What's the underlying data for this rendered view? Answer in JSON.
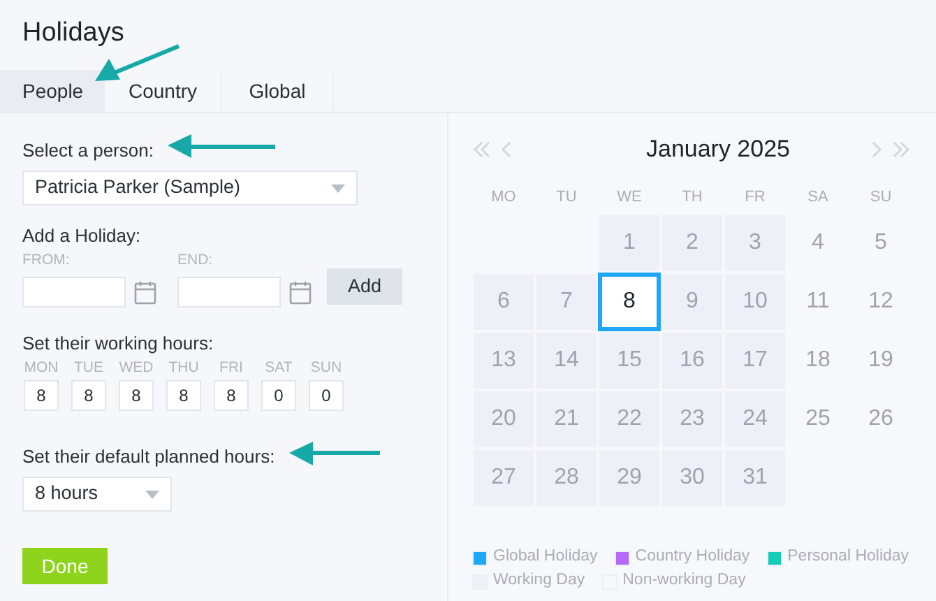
{
  "title": "Holidays",
  "tabs": [
    {
      "label": "People",
      "selected": true
    },
    {
      "label": "Country",
      "selected": false
    },
    {
      "label": "Global",
      "selected": false
    }
  ],
  "person": {
    "label": "Select a person:",
    "value": "Patricia Parker (Sample)"
  },
  "add_holiday": {
    "label": "Add a Holiday:",
    "from_label": "FROM:",
    "end_label": "END:",
    "button": "Add"
  },
  "working_hours": {
    "label": "Set their working hours:",
    "days": [
      {
        "day": "MON",
        "hours": "8"
      },
      {
        "day": "TUE",
        "hours": "8"
      },
      {
        "day": "WED",
        "hours": "8"
      },
      {
        "day": "THU",
        "hours": "8"
      },
      {
        "day": "FRI",
        "hours": "8"
      },
      {
        "day": "SAT",
        "hours": "0"
      },
      {
        "day": "SUN",
        "hours": "0"
      }
    ]
  },
  "planned_hours": {
    "label": "Set their default planned hours:",
    "value": "8 hours"
  },
  "done_button": "Done",
  "calendar": {
    "month": "January 2025",
    "weekdays": [
      "MO",
      "TU",
      "WE",
      "TH",
      "FR",
      "SA",
      "SU"
    ],
    "weeks": [
      [
        {
          "day": "1",
          "kind": "working",
          "selected": false
        },
        {
          "day": "2",
          "kind": "working",
          "selected": false
        },
        {
          "day": "3",
          "kind": "working",
          "selected": false
        },
        {
          "day": "4",
          "kind": "nonworking",
          "selected": false
        },
        {
          "day": "5",
          "kind": "nonworking",
          "selected": false
        }
      ],
      [
        {
          "day": "6",
          "kind": "working",
          "selected": false
        },
        {
          "day": "7",
          "kind": "working",
          "selected": false
        },
        {
          "day": "8",
          "kind": "working",
          "selected": true
        },
        {
          "day": "9",
          "kind": "working",
          "selected": false
        },
        {
          "day": "10",
          "kind": "working",
          "selected": false
        },
        {
          "day": "11",
          "kind": "nonworking",
          "selected": false
        },
        {
          "day": "12",
          "kind": "nonworking",
          "selected": false
        }
      ],
      [
        {
          "day": "13",
          "kind": "working",
          "selected": false
        },
        {
          "day": "14",
          "kind": "working",
          "selected": false
        },
        {
          "day": "15",
          "kind": "working",
          "selected": false
        },
        {
          "day": "16",
          "kind": "working",
          "selected": false
        },
        {
          "day": "17",
          "kind": "working",
          "selected": false
        },
        {
          "day": "18",
          "kind": "nonworking",
          "selected": false
        },
        {
          "day": "19",
          "kind": "nonworking",
          "selected": false
        }
      ],
      [
        {
          "day": "20",
          "kind": "working",
          "selected": false
        },
        {
          "day": "21",
          "kind": "working",
          "selected": false
        },
        {
          "day": "22",
          "kind": "working",
          "selected": false
        },
        {
          "day": "23",
          "kind": "working",
          "selected": false
        },
        {
          "day": "24",
          "kind": "working",
          "selected": false
        },
        {
          "day": "25",
          "kind": "nonworking",
          "selected": false
        },
        {
          "day": "26",
          "kind": "nonworking",
          "selected": false
        }
      ],
      [
        {
          "day": "27",
          "kind": "working",
          "selected": false
        },
        {
          "day": "28",
          "kind": "working",
          "selected": false
        },
        {
          "day": "29",
          "kind": "working",
          "selected": false
        },
        {
          "day": "30",
          "kind": "working",
          "selected": false
        },
        {
          "day": "31",
          "kind": "working",
          "selected": false
        }
      ]
    ]
  },
  "legend": [
    {
      "label": "Global Holiday",
      "color": "#1ea7fd"
    },
    {
      "label": "Country Holiday",
      "color": "#b36bf7"
    },
    {
      "label": "Personal Holiday",
      "color": "#14cdb8"
    },
    {
      "label": "Working Day",
      "color": "#edf1f7"
    },
    {
      "label": "Non-working Day",
      "color": "#f7f8fc"
    }
  ]
}
